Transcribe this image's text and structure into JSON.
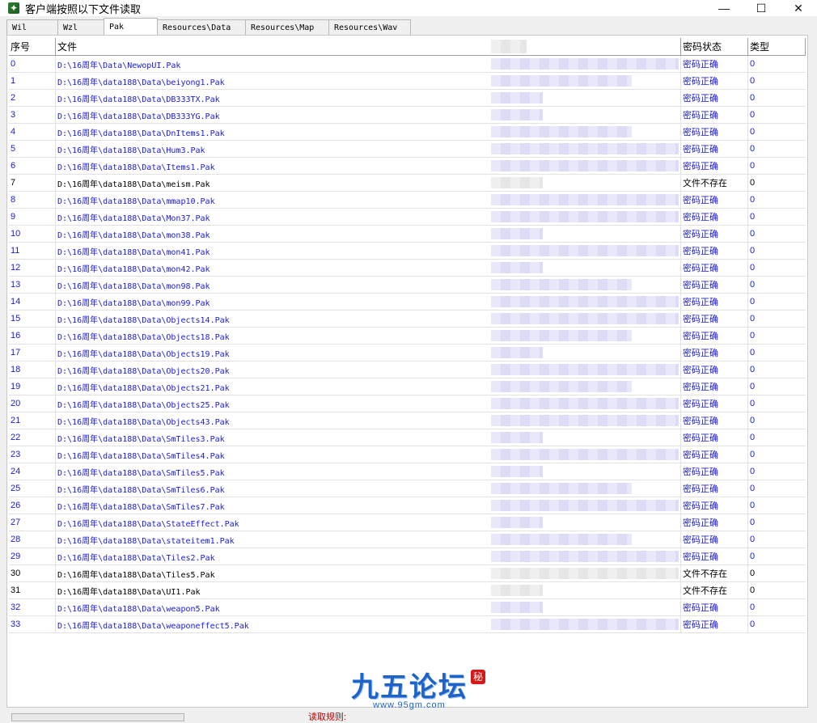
{
  "window": {
    "title": "客户端按照以下文件读取",
    "controls": {
      "minimize": "—",
      "maximize": "☐",
      "close": "✕"
    }
  },
  "tabs": [
    {
      "label": "Wil"
    },
    {
      "label": "Wzl"
    },
    {
      "label": "Pak",
      "active": true
    },
    {
      "label": "Resources\\Data"
    },
    {
      "label": "Resources\\Map"
    },
    {
      "label": "Resources\\Wav"
    }
  ],
  "table": {
    "headers": {
      "index": "序号",
      "file": "文件",
      "status": "密码状态",
      "type": "类型"
    },
    "rows": [
      {
        "index": "0",
        "file": "D:\\16周年\\Data\\NewopUI.Pak",
        "status": "密码正确",
        "type": "0"
      },
      {
        "index": "1",
        "file": "D:\\16周年\\data188\\Data\\beiyong1.Pak",
        "status": "密码正确",
        "type": "0"
      },
      {
        "index": "2",
        "file": "D:\\16周年\\data188\\Data\\DB333TX.Pak",
        "status": "密码正确",
        "type": "0"
      },
      {
        "index": "3",
        "file": "D:\\16周年\\data188\\Data\\DB333YG.Pak",
        "status": "密码正确",
        "type": "0"
      },
      {
        "index": "4",
        "file": "D:\\16周年\\data188\\Data\\DnItems1.Pak",
        "status": "密码正确",
        "type": "0"
      },
      {
        "index": "5",
        "file": "D:\\16周年\\data188\\Data\\Hum3.Pak",
        "status": "密码正确",
        "type": "0"
      },
      {
        "index": "6",
        "file": "D:\\16周年\\data188\\Data\\Items1.Pak",
        "status": "密码正确",
        "type": "0"
      },
      {
        "index": "7",
        "file": "D:\\16周年\\data188\\Data\\meism.Pak",
        "status": "文件不存在",
        "type": "0"
      },
      {
        "index": "8",
        "file": "D:\\16周年\\data188\\Data\\mmap10.Pak",
        "status": "密码正确",
        "type": "0"
      },
      {
        "index": "9",
        "file": "D:\\16周年\\data188\\Data\\Mon37.Pak",
        "status": "密码正确",
        "type": "0"
      },
      {
        "index": "10",
        "file": "D:\\16周年\\data188\\Data\\mon38.Pak",
        "status": "密码正确",
        "type": "0"
      },
      {
        "index": "11",
        "file": "D:\\16周年\\data188\\Data\\mon41.Pak",
        "status": "密码正确",
        "type": "0"
      },
      {
        "index": "12",
        "file": "D:\\16周年\\data188\\Data\\mon42.Pak",
        "status": "密码正确",
        "type": "0"
      },
      {
        "index": "13",
        "file": "D:\\16周年\\data188\\Data\\mon98.Pak",
        "status": "密码正确",
        "type": "0"
      },
      {
        "index": "14",
        "file": "D:\\16周年\\data188\\Data\\mon99.Pak",
        "status": "密码正确",
        "type": "0"
      },
      {
        "index": "15",
        "file": "D:\\16周年\\data188\\Data\\Objects14.Pak",
        "status": "密码正确",
        "type": "0"
      },
      {
        "index": "16",
        "file": "D:\\16周年\\data188\\Data\\Objects18.Pak",
        "status": "密码正确",
        "type": "0"
      },
      {
        "index": "17",
        "file": "D:\\16周年\\data188\\Data\\Objects19.Pak",
        "status": "密码正确",
        "type": "0"
      },
      {
        "index": "18",
        "file": "D:\\16周年\\data188\\Data\\Objects20.Pak",
        "status": "密码正确",
        "type": "0"
      },
      {
        "index": "19",
        "file": "D:\\16周年\\data188\\Data\\Objects21.Pak",
        "status": "密码正确",
        "type": "0"
      },
      {
        "index": "20",
        "file": "D:\\16周年\\data188\\Data\\Objects25.Pak",
        "status": "密码正确",
        "type": "0"
      },
      {
        "index": "21",
        "file": "D:\\16周年\\data188\\Data\\Objects43.Pak",
        "status": "密码正确",
        "type": "0"
      },
      {
        "index": "22",
        "file": "D:\\16周年\\data188\\Data\\SmTiles3.Pak",
        "status": "密码正确",
        "type": "0"
      },
      {
        "index": "23",
        "file": "D:\\16周年\\data188\\Data\\SmTiles4.Pak",
        "status": "密码正确",
        "type": "0"
      },
      {
        "index": "24",
        "file": "D:\\16周年\\data188\\Data\\SmTiles5.Pak",
        "status": "密码正确",
        "type": "0"
      },
      {
        "index": "25",
        "file": "D:\\16周年\\data188\\Data\\SmTiles6.Pak",
        "status": "密码正确",
        "type": "0"
      },
      {
        "index": "26",
        "file": "D:\\16周年\\data188\\Data\\SmTiles7.Pak",
        "status": "密码正确",
        "type": "0"
      },
      {
        "index": "27",
        "file": "D:\\16周年\\data188\\Data\\StateEffect.Pak",
        "status": "密码正确",
        "type": "0"
      },
      {
        "index": "28",
        "file": "D:\\16周年\\data188\\Data\\stateitem1.Pak",
        "status": "密码正确",
        "type": "0"
      },
      {
        "index": "29",
        "file": "D:\\16周年\\data188\\Data\\Tiles2.Pak",
        "status": "密码正确",
        "type": "0"
      },
      {
        "index": "30",
        "file": "D:\\16周年\\data188\\Data\\Tiles5.Pak",
        "status": "文件不存在",
        "type": "0"
      },
      {
        "index": "31",
        "file": "D:\\16周年\\data188\\Data\\UI1.Pak",
        "status": "文件不存在",
        "type": "0"
      },
      {
        "index": "32",
        "file": "D:\\16周年\\data188\\Data\\weapon5.Pak",
        "status": "密码正确",
        "type": "0"
      },
      {
        "index": "33",
        "file": "D:\\16周年\\data188\\Data\\weaponeffect5.Pak",
        "status": "密码正确",
        "type": "0"
      }
    ]
  },
  "watermark": {
    "logo_text": "九五论坛",
    "url": "www.95gm.com",
    "seal": "秘"
  },
  "footer": {
    "rule_label": "读取规则:"
  },
  "colors": {
    "ok_text": "#1b1bd6",
    "missing_text": "#000000",
    "logo": "#1e63c7"
  }
}
